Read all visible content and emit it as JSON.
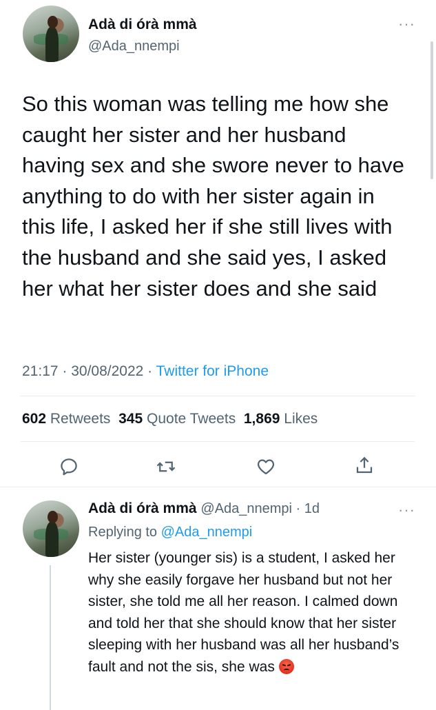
{
  "main_tweet": {
    "display_name": "Adà di órà mmà",
    "handle": "@Ada_nnempi",
    "more_icon": "more-horizontal-icon",
    "text": "So this woman was telling me how she caught her sister and her husband having sex and she swore never to have anything to do with her sister again in this life, I asked her if she still lives with the husband and she said yes, I asked her what her sister does and she said",
    "time_date": "21:17 · 30/08/2022 · ",
    "source": "Twitter for iPhone",
    "stats": {
      "retweets_count": "602",
      "retweets_label": "Retweets",
      "quotes_count": "345",
      "quotes_label": "Quote Tweets",
      "likes_count": "1,869",
      "likes_label": "Likes"
    },
    "actions": [
      "reply-icon",
      "retweet-icon",
      "like-icon",
      "share-icon"
    ]
  },
  "reply_tweet": {
    "display_name": "Adà di órà mmà",
    "handle_time": "@Ada_nnempi · 1d",
    "replying_prefix": "Replying to ",
    "replying_to": "@Ada_nnempi",
    "text": "Her sister (younger sis) is a student, I asked her why she easily forgave her husband but not her sister, she told me all her reason. I calmed down and told her that she should know that her sister sleeping with her husband was all her husband’s fault and not the sis, she was",
    "emoji": "angry-face-emoji"
  },
  "colors": {
    "accent": "#1d9bf0",
    "text": "#0f1419",
    "secondary": "#536471",
    "divider": "#e6ecf0"
  }
}
